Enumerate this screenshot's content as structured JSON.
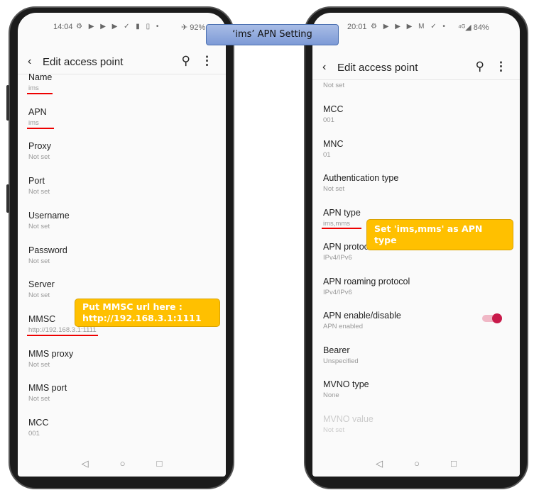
{
  "annotation_title": "‘ims’ APN Setting",
  "left_phone": {
    "status": {
      "time": "14:04",
      "icons": "⚙ ▶ ▶ ▶ ✓ ▮ ▯ •",
      "right": "✈ 92%"
    },
    "appbar": {
      "title": "Edit access point"
    },
    "items": [
      {
        "label": "Name",
        "value": "ims"
      },
      {
        "label": "APN",
        "value": "ims"
      },
      {
        "label": "Proxy",
        "value": "Not set"
      },
      {
        "label": "Port",
        "value": "Not set"
      },
      {
        "label": "Username",
        "value": "Not set"
      },
      {
        "label": "Password",
        "value": "Not set"
      },
      {
        "label": "Server",
        "value": "Not set"
      },
      {
        "label": "MMSC",
        "value": "http://192.168.3.1:1111"
      },
      {
        "label": "MMS proxy",
        "value": "Not set"
      },
      {
        "label": "MMS port",
        "value": "Not set"
      },
      {
        "label": "MCC",
        "value": "001"
      }
    ],
    "callout": {
      "line1": "Put MMSC url here :",
      "line2": "http://192.168.3.1:1111"
    }
  },
  "right_phone": {
    "status": {
      "time": "20:01",
      "icons": "⚙ ▶ ▶ ▶ M ✓ •",
      "right": "⁴ᴳ◢ 84%"
    },
    "appbar": {
      "title": "Edit access point"
    },
    "top_value": "Not set",
    "items": [
      {
        "label": "MCC",
        "value": "001"
      },
      {
        "label": "MNC",
        "value": "01"
      },
      {
        "label": "Authentication type",
        "value": "Not set"
      },
      {
        "label": "APN type",
        "value": "ims,mms"
      },
      {
        "label": "APN protocol",
        "value": "IPv4/IPv6"
      },
      {
        "label": "APN roaming protocol",
        "value": "IPv4/IPv6"
      },
      {
        "label": "APN enable/disable",
        "value": "APN enabled",
        "toggle_on": true
      },
      {
        "label": "Bearer",
        "value": "Unspecified"
      },
      {
        "label": "MVNO type",
        "value": "None"
      },
      {
        "label": "MVNO value",
        "value": "Not set",
        "disabled": true
      }
    ],
    "callout": {
      "line1": "Set 'ims,mms' as APN type"
    }
  },
  "colors": {
    "callout": "#FFC000",
    "underline": "#e00000",
    "toggle": "#c8194a"
  }
}
